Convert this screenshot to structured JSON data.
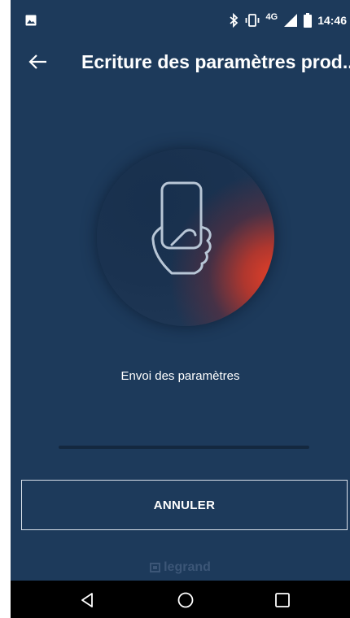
{
  "status_bar": {
    "time": "14:46",
    "network": "4G",
    "icons": [
      "gallery-icon",
      "bluetooth-icon",
      "vibrate-icon",
      "signal-icon",
      "battery-icon"
    ]
  },
  "app_bar": {
    "title": "Ecriture des paramètres prod...",
    "back_icon": "arrow-left-icon"
  },
  "illustration": {
    "icon": "phone-in-hand-icon",
    "accent_color": "#e8452f"
  },
  "progress": {
    "label": "Envoi des paramètres",
    "value": 0
  },
  "actions": {
    "cancel_label": "ANNULER"
  },
  "footer": {
    "logo_text": "legrand"
  },
  "navigation": {
    "icons": [
      "nav-back-icon",
      "nav-home-icon",
      "nav-recents-icon"
    ]
  },
  "colors": {
    "background": "#1d3a5b",
    "text": "#ffffff",
    "logo": "#3c5677"
  }
}
